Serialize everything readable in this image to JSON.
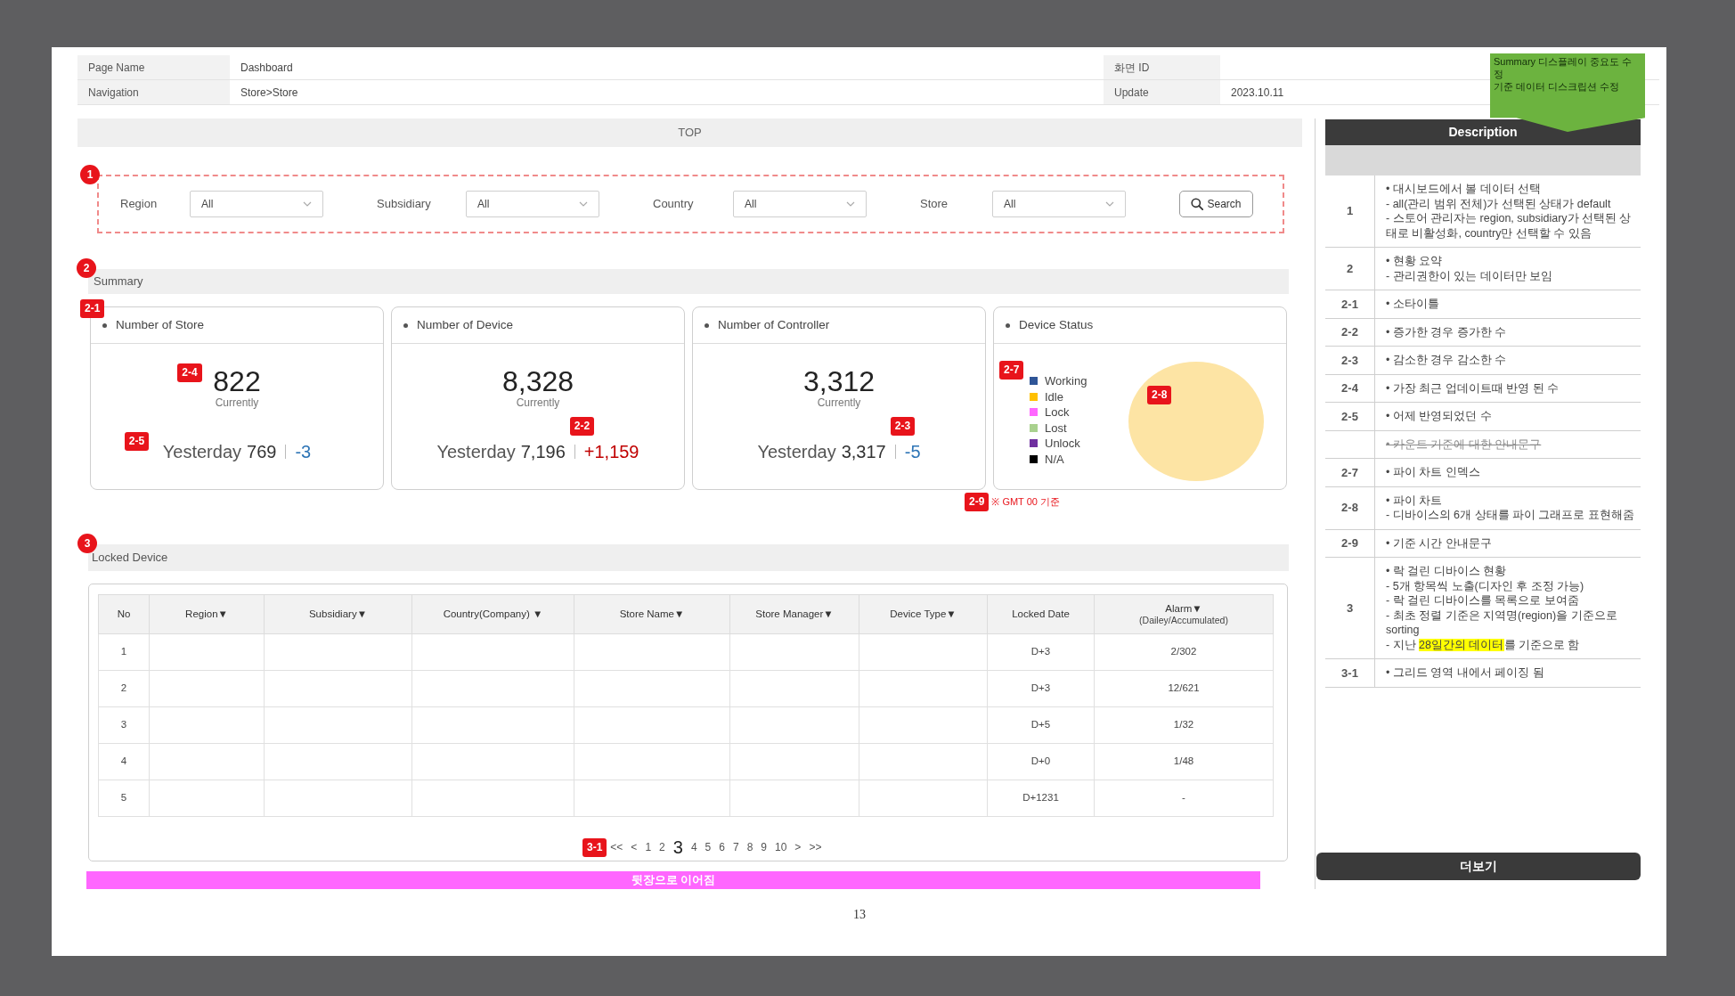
{
  "header_fields": [
    {
      "label": "Page Name",
      "value": "Dashboard"
    },
    {
      "label": "화면 ID"
    },
    {
      "label": "Navigation",
      "value": "Store>Store"
    },
    {
      "label": "Update",
      "value": "2023.10.11"
    }
  ],
  "callout": {
    "lines": [
      "Summary 디스플레이 중요도 수정",
      "기준 데이터 디스크립션 수정"
    ]
  },
  "top_bar": {
    "title": "TOP"
  },
  "filters": {
    "marker": "1",
    "fields": [
      {
        "label": "Region",
        "value": "All"
      },
      {
        "label": "Subsidiary",
        "value": "All"
      },
      {
        "label": "Country",
        "value": "All"
      },
      {
        "label": "Store",
        "value": "All"
      }
    ],
    "search_button": "Search"
  },
  "summary": {
    "marker": "2",
    "title": "Summary",
    "cards": [
      {
        "kind": "stat",
        "title": "Number of Store",
        "tag": "2-1",
        "value": "822",
        "value_tag": "2-4",
        "caption": "Currently",
        "yesterday_label": "Yesterday",
        "yesterday_value": "769",
        "yesterday_tag": "2-5",
        "delta": "-3",
        "increased": false
      },
      {
        "kind": "stat",
        "title": "Number of Device",
        "value": "8,328",
        "caption": "Currently",
        "yesterday_label": "Yesterday",
        "yesterday_value": "7,196",
        "delta": "+1,159",
        "delta_tag": "2-2",
        "increased": true
      },
      {
        "kind": "stat",
        "title": "Number of Controller",
        "value": "3,312",
        "caption": "Currently",
        "yesterday_label": "Yesterday",
        "yesterday_value": "3,317",
        "delta": "-5",
        "delta_tag": "2-3",
        "increased": false
      },
      {
        "kind": "status",
        "title": "Device Status",
        "legend_tag": "2-7",
        "chart_tag": "2-8",
        "legend": [
          {
            "label": "Working",
            "color": "#2f5597"
          },
          {
            "label": "Idle",
            "color": "#ffc000"
          },
          {
            "label": "Lock",
            "color": "#ff66ff"
          },
          {
            "label": "Lost",
            "color": "#a9d18e"
          },
          {
            "label": "Unlock",
            "color": "#7030a0"
          },
          {
            "label": "N/A",
            "color": "#000000"
          }
        ]
      }
    ],
    "note_tag": "2-9",
    "note": "※ GMT 00 기준"
  },
  "locked_device": {
    "marker": "3",
    "title": "Locked Device",
    "columns": [
      {
        "label": "No"
      },
      {
        "label": "Region▼"
      },
      {
        "label": "Subsidiary▼"
      },
      {
        "label": "Country(Company) ▼"
      },
      {
        "label": "Store Name▼"
      },
      {
        "label": "Store Manager▼"
      },
      {
        "label": "Device Type▼"
      },
      {
        "label": "Locked Date"
      },
      {
        "label": "Alarm▼",
        "sublabel": "(Dailey/Accumulated)"
      }
    ],
    "rows": [
      {
        "no": "1",
        "locked_date": "D+3",
        "alarm": "2/302"
      },
      {
        "no": "2",
        "locked_date": "D+3",
        "alarm": "12/621"
      },
      {
        "no": "3",
        "locked_date": "D+5",
        "alarm": "1/32"
      },
      {
        "no": "4",
        "locked_date": "D+0",
        "alarm": "1/48"
      },
      {
        "no": "5",
        "locked_date": "D+1231",
        "alarm": "-"
      }
    ],
    "pagination": {
      "tag": "3-1",
      "items": [
        {
          "label": "<<",
          "selected": false
        },
        {
          "label": "<",
          "selected": false
        },
        {
          "label": "1",
          "selected": false
        },
        {
          "label": "2",
          "selected": false
        },
        {
          "label": "3",
          "selected": true
        },
        {
          "label": "4",
          "selected": false
        },
        {
          "label": "5",
          "selected": false
        },
        {
          "label": "6",
          "selected": false
        },
        {
          "label": "7",
          "selected": false
        },
        {
          "label": "8",
          "selected": false
        },
        {
          "label": "9",
          "selected": false
        },
        {
          "label": "10",
          "selected": false
        },
        {
          "label": ">",
          "selected": false
        },
        {
          "label": ">>",
          "selected": false
        }
      ]
    }
  },
  "continuation_banner": {
    "text": "뒷장으로 이어짐"
  },
  "description": {
    "title": "Description",
    "rows": [
      {
        "no": "1",
        "struck": false,
        "lines": [
          "• 대시보드에서 볼 데이터 선택",
          "- all(관리 범위 전체)가 선택된 상태가 default",
          "- 스토어 관리자는 region, subsidiary가 선택된 상태로 비활성화, country만 선택할 수 있음"
        ]
      },
      {
        "no": "2",
        "struck": false,
        "lines": [
          "• 현황 요약",
          "- 관리권한이 있는 데이터만 보임"
        ]
      },
      {
        "no": "2-1",
        "struck": false,
        "lines": [
          "• 소타이틀"
        ]
      },
      {
        "no": "2-2",
        "struck": false,
        "lines": [
          "• 증가한 경우 증가한 수"
        ]
      },
      {
        "no": "2-3",
        "struck": false,
        "lines": [
          "• 감소한 경우 감소한 수"
        ]
      },
      {
        "no": "2-4",
        "struck": false,
        "lines": [
          "• 가장 최근 업데이트때 반영 된 수"
        ]
      },
      {
        "no": "2-5",
        "struck": false,
        "lines": [
          "• 어제 반영되었던 수"
        ]
      },
      {
        "struck": true,
        "lines": [
          "• 카운트 기준에 대한 안내문구"
        ]
      },
      {
        "no": "2-7",
        "struck": false,
        "lines": [
          "• 파이 차트 인덱스"
        ]
      },
      {
        "no": "2-8",
        "struck": false,
        "lines": [
          "• 파이 차트",
          "- 디바이스의 6개 상태를 파이 그래프로 표현해줌"
        ]
      },
      {
        "no": "2-9",
        "struck": false,
        "lines": [
          "• 기준 시간 안내문구"
        ]
      },
      {
        "no": "3",
        "struck": false,
        "lines": [
          "• 락 걸린 디바이스 현황",
          "- 5개 항목씩 노출(디자인 후 조정 가능)",
          "- 락 걸린 디바이스를 목록으로 보여줌",
          "- 최초 정렬 기준은 지역명(region)을 기준으로 sorting",
          [
            {
              "text": "- 지난 ",
              "highlighted": false
            },
            {
              "text": "28일간의 데이터",
              "highlighted": true
            },
            {
              "text": "를 기준으로 함",
              "highlighted": false
            }
          ]
        ]
      },
      {
        "no": "3-1",
        "struck": false,
        "lines": [
          "• 그리드 영역 내에서 페이징 됨"
        ]
      }
    ],
    "more_button": "더보기"
  },
  "page_number": "13"
}
